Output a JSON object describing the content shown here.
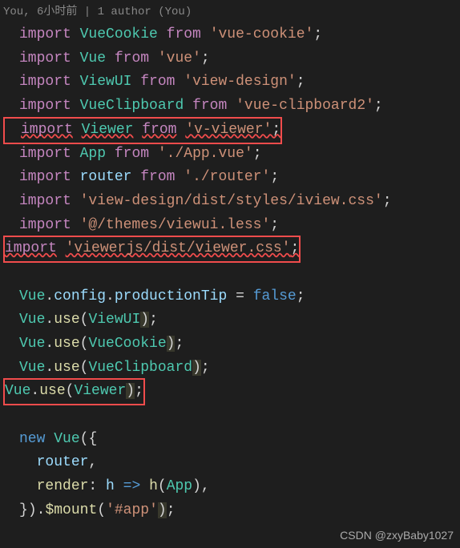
{
  "gitlens": "You, 6小时前 | 1 author (You)",
  "t": {
    "import": "import",
    "from": "from",
    "new": "new",
    "false": "false",
    "VueCookie": "VueCookie",
    "Vue": "Vue",
    "ViewUI": "ViewUI",
    "VueClipboard": "VueClipboard",
    "Viewer": "Viewer",
    "App": "App",
    "router": "router",
    "config": "config",
    "productionTip": "productionTip",
    "use": "use",
    "render": "render",
    "h": "h",
    "mount": "$mount",
    "comma": ",",
    "dot": ".",
    "semi": ";",
    "assign": " = ",
    "arrow": " => ",
    "lp": "(",
    "rp": ")",
    "lb": "{",
    "rb": "}",
    "colon": ": "
  },
  "s": {
    "vue_cookie": "'vue-cookie'",
    "vue": "'vue'",
    "view_design": "'view-design'",
    "vue_clipboard2": "'vue-clipboard2'",
    "v_viewer": "'v-viewer'",
    "app_vue": "'./App.vue'",
    "router": "'./router'",
    "iview_css": "'view-design/dist/styles/iview.css'",
    "viewui_less": "'@/themes/viewui.less'",
    "viewerjs_css": "'viewerjs/dist/viewer.css'",
    "app_mount": "'#app'"
  },
  "watermark": "CSDN @zxyBaby1027"
}
